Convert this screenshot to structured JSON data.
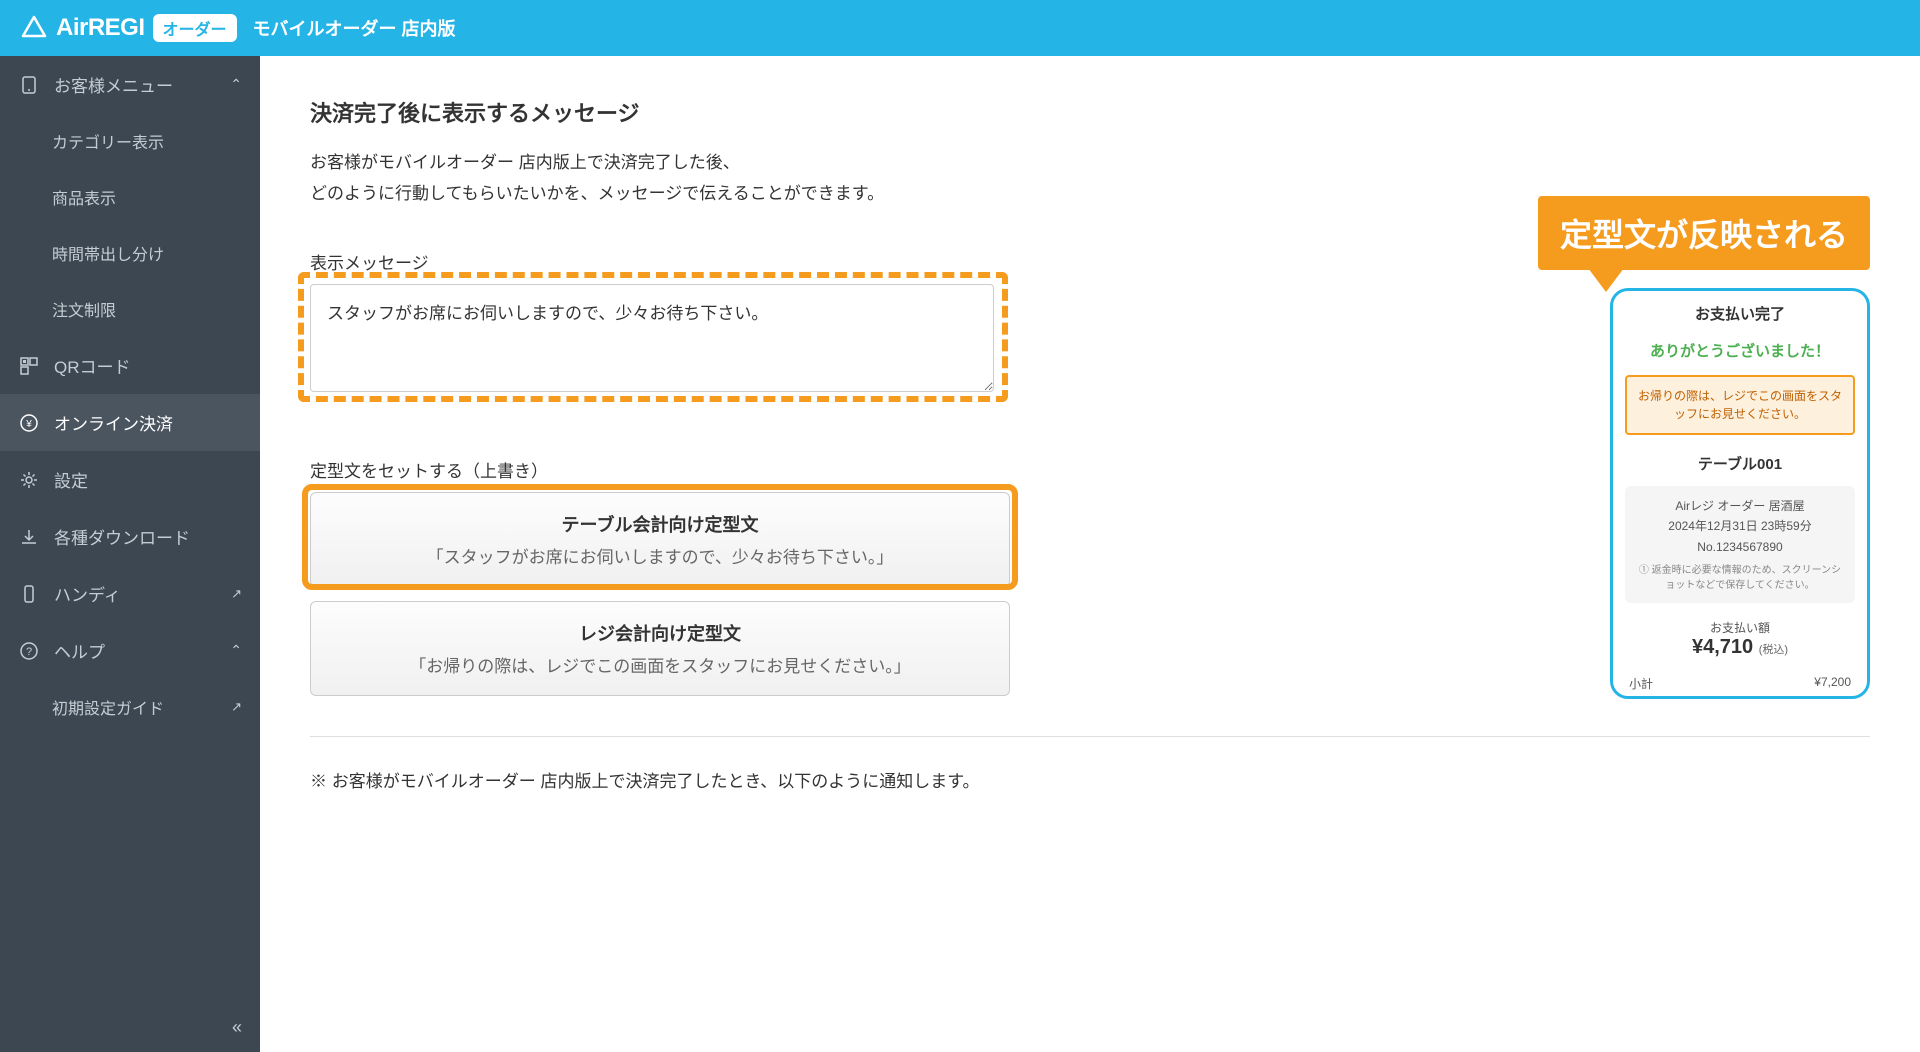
{
  "header": {
    "logo_text": "AirREGI",
    "logo_badge": "オーダー",
    "subtitle": "モバイルオーダー 店内版"
  },
  "sidebar": {
    "customer_menu": "お客様メニュー",
    "items": {
      "category": "カテゴリー表示",
      "product": "商品表示",
      "timeband": "時間帯出し分け",
      "order_limit": "注文制限",
      "qr": "QRコード",
      "online_payment": "オンライン決済",
      "settings": "設定",
      "downloads": "各種ダウンロード",
      "handy": "ハンディ",
      "help": "ヘルプ",
      "setup_guide": "初期設定ガイド"
    }
  },
  "main": {
    "title": "決済完了後に表示するメッセージ",
    "desc_line1": "お客様がモバイルオーダー 店内版上で決済完了した後、",
    "desc_line2": "どのように行動してもらいたいかを、メッセージで伝えることができます。",
    "field_label": "表示メッセージ",
    "textarea_value": "スタッフがお席にお伺いしますので、少々お待ち下さい。",
    "preset_label": "定型文をセットする（上書き）",
    "preset1_title": "テーブル会計向け定型文",
    "preset1_desc": "「スタッフがお席にお伺いしますので、少々お待ち下さい。」",
    "preset2_title": "レジ会計向け定型文",
    "preset2_desc": "「お帰りの際は、レジでこの画面をスタッフにお見せください。」",
    "footnote": "※ お客様がモバイルオーダー 店内版上で決済完了したとき、以下のように通知します。"
  },
  "callout": "定型文が反映される",
  "phone": {
    "header": "お支払い完了",
    "thanks": "ありがとうございました！",
    "notice": "お帰りの際は、レジでこの画面をスタッフにお見せください。",
    "table": "テーブル001",
    "shop": "Airレジ オーダー 居酒屋",
    "datetime": "2024年12月31日 23時59分",
    "order_no": "No.1234567890",
    "info_note": "① 返金時に必要な情報のため、スクリーンショットなどで保存してください。",
    "total_label": "お支払い額",
    "total": "¥4,710",
    "tax_note": "(税込)",
    "subtotal_label": "小計",
    "subtotal_value": "¥7,200"
  }
}
